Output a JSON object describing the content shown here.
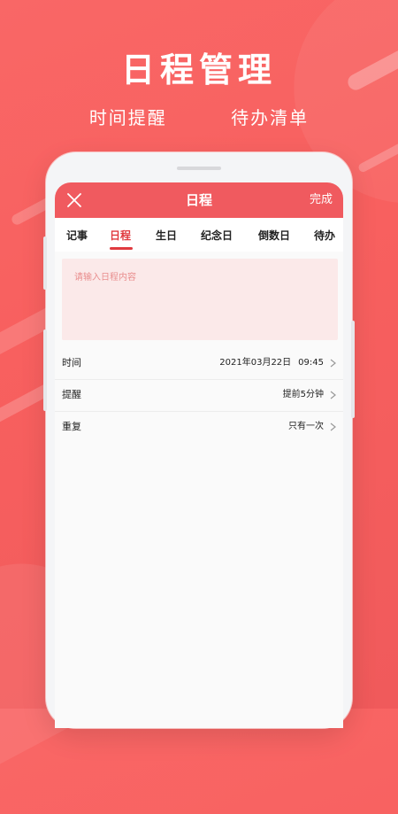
{
  "hero": {
    "title": "日程管理",
    "subtitle_left": "时间提醒",
    "subtitle_right": "待办清单"
  },
  "nav": {
    "close_icon": "close-icon",
    "title": "日程",
    "done_label": "完成"
  },
  "tabs": [
    {
      "label": "记事",
      "active": false
    },
    {
      "label": "日程",
      "active": true
    },
    {
      "label": "生日",
      "active": false
    },
    {
      "label": "纪念日",
      "active": false
    },
    {
      "label": "倒数日",
      "active": false
    },
    {
      "label": "待办",
      "active": false
    }
  ],
  "content": {
    "placeholder": "请输入日程内容"
  },
  "settings": {
    "time": {
      "label": "时间",
      "date": "2021年03月22日",
      "clock": "09:45"
    },
    "remind": {
      "label": "提醒",
      "value": "提前5分钟"
    },
    "repeat": {
      "label": "重复",
      "value": "只有一次"
    }
  },
  "colors": {
    "background": "#f8605f",
    "accent": "#f05a5f",
    "active_tab": "#e03a3f",
    "input_background": "#fbe9e9"
  }
}
